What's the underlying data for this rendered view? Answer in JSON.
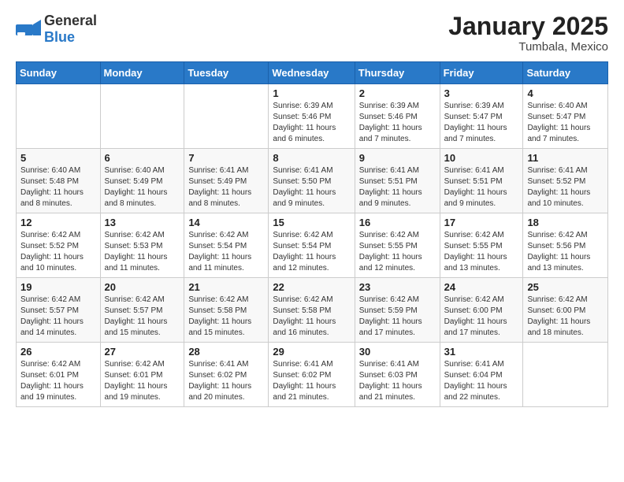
{
  "header": {
    "logo_general": "General",
    "logo_blue": "Blue",
    "title": "January 2025",
    "subtitle": "Tumbala, Mexico"
  },
  "days_of_week": [
    "Sunday",
    "Monday",
    "Tuesday",
    "Wednesday",
    "Thursday",
    "Friday",
    "Saturday"
  ],
  "weeks": [
    [
      {
        "day": "",
        "info": ""
      },
      {
        "day": "",
        "info": ""
      },
      {
        "day": "",
        "info": ""
      },
      {
        "day": "1",
        "info": "Sunrise: 6:39 AM\nSunset: 5:46 PM\nDaylight: 11 hours and 6 minutes."
      },
      {
        "day": "2",
        "info": "Sunrise: 6:39 AM\nSunset: 5:46 PM\nDaylight: 11 hours and 7 minutes."
      },
      {
        "day": "3",
        "info": "Sunrise: 6:39 AM\nSunset: 5:47 PM\nDaylight: 11 hours and 7 minutes."
      },
      {
        "day": "4",
        "info": "Sunrise: 6:40 AM\nSunset: 5:47 PM\nDaylight: 11 hours and 7 minutes."
      }
    ],
    [
      {
        "day": "5",
        "info": "Sunrise: 6:40 AM\nSunset: 5:48 PM\nDaylight: 11 hours and 8 minutes."
      },
      {
        "day": "6",
        "info": "Sunrise: 6:40 AM\nSunset: 5:49 PM\nDaylight: 11 hours and 8 minutes."
      },
      {
        "day": "7",
        "info": "Sunrise: 6:41 AM\nSunset: 5:49 PM\nDaylight: 11 hours and 8 minutes."
      },
      {
        "day": "8",
        "info": "Sunrise: 6:41 AM\nSunset: 5:50 PM\nDaylight: 11 hours and 9 minutes."
      },
      {
        "day": "9",
        "info": "Sunrise: 6:41 AM\nSunset: 5:51 PM\nDaylight: 11 hours and 9 minutes."
      },
      {
        "day": "10",
        "info": "Sunrise: 6:41 AM\nSunset: 5:51 PM\nDaylight: 11 hours and 9 minutes."
      },
      {
        "day": "11",
        "info": "Sunrise: 6:41 AM\nSunset: 5:52 PM\nDaylight: 11 hours and 10 minutes."
      }
    ],
    [
      {
        "day": "12",
        "info": "Sunrise: 6:42 AM\nSunset: 5:52 PM\nDaylight: 11 hours and 10 minutes."
      },
      {
        "day": "13",
        "info": "Sunrise: 6:42 AM\nSunset: 5:53 PM\nDaylight: 11 hours and 11 minutes."
      },
      {
        "day": "14",
        "info": "Sunrise: 6:42 AM\nSunset: 5:54 PM\nDaylight: 11 hours and 11 minutes."
      },
      {
        "day": "15",
        "info": "Sunrise: 6:42 AM\nSunset: 5:54 PM\nDaylight: 11 hours and 12 minutes."
      },
      {
        "day": "16",
        "info": "Sunrise: 6:42 AM\nSunset: 5:55 PM\nDaylight: 11 hours and 12 minutes."
      },
      {
        "day": "17",
        "info": "Sunrise: 6:42 AM\nSunset: 5:55 PM\nDaylight: 11 hours and 13 minutes."
      },
      {
        "day": "18",
        "info": "Sunrise: 6:42 AM\nSunset: 5:56 PM\nDaylight: 11 hours and 13 minutes."
      }
    ],
    [
      {
        "day": "19",
        "info": "Sunrise: 6:42 AM\nSunset: 5:57 PM\nDaylight: 11 hours and 14 minutes."
      },
      {
        "day": "20",
        "info": "Sunrise: 6:42 AM\nSunset: 5:57 PM\nDaylight: 11 hours and 15 minutes."
      },
      {
        "day": "21",
        "info": "Sunrise: 6:42 AM\nSunset: 5:58 PM\nDaylight: 11 hours and 15 minutes."
      },
      {
        "day": "22",
        "info": "Sunrise: 6:42 AM\nSunset: 5:58 PM\nDaylight: 11 hours and 16 minutes."
      },
      {
        "day": "23",
        "info": "Sunrise: 6:42 AM\nSunset: 5:59 PM\nDaylight: 11 hours and 17 minutes."
      },
      {
        "day": "24",
        "info": "Sunrise: 6:42 AM\nSunset: 6:00 PM\nDaylight: 11 hours and 17 minutes."
      },
      {
        "day": "25",
        "info": "Sunrise: 6:42 AM\nSunset: 6:00 PM\nDaylight: 11 hours and 18 minutes."
      }
    ],
    [
      {
        "day": "26",
        "info": "Sunrise: 6:42 AM\nSunset: 6:01 PM\nDaylight: 11 hours and 19 minutes."
      },
      {
        "day": "27",
        "info": "Sunrise: 6:42 AM\nSunset: 6:01 PM\nDaylight: 11 hours and 19 minutes."
      },
      {
        "day": "28",
        "info": "Sunrise: 6:41 AM\nSunset: 6:02 PM\nDaylight: 11 hours and 20 minutes."
      },
      {
        "day": "29",
        "info": "Sunrise: 6:41 AM\nSunset: 6:02 PM\nDaylight: 11 hours and 21 minutes."
      },
      {
        "day": "30",
        "info": "Sunrise: 6:41 AM\nSunset: 6:03 PM\nDaylight: 11 hours and 21 minutes."
      },
      {
        "day": "31",
        "info": "Sunrise: 6:41 AM\nSunset: 6:04 PM\nDaylight: 11 hours and 22 minutes."
      },
      {
        "day": "",
        "info": ""
      }
    ]
  ]
}
